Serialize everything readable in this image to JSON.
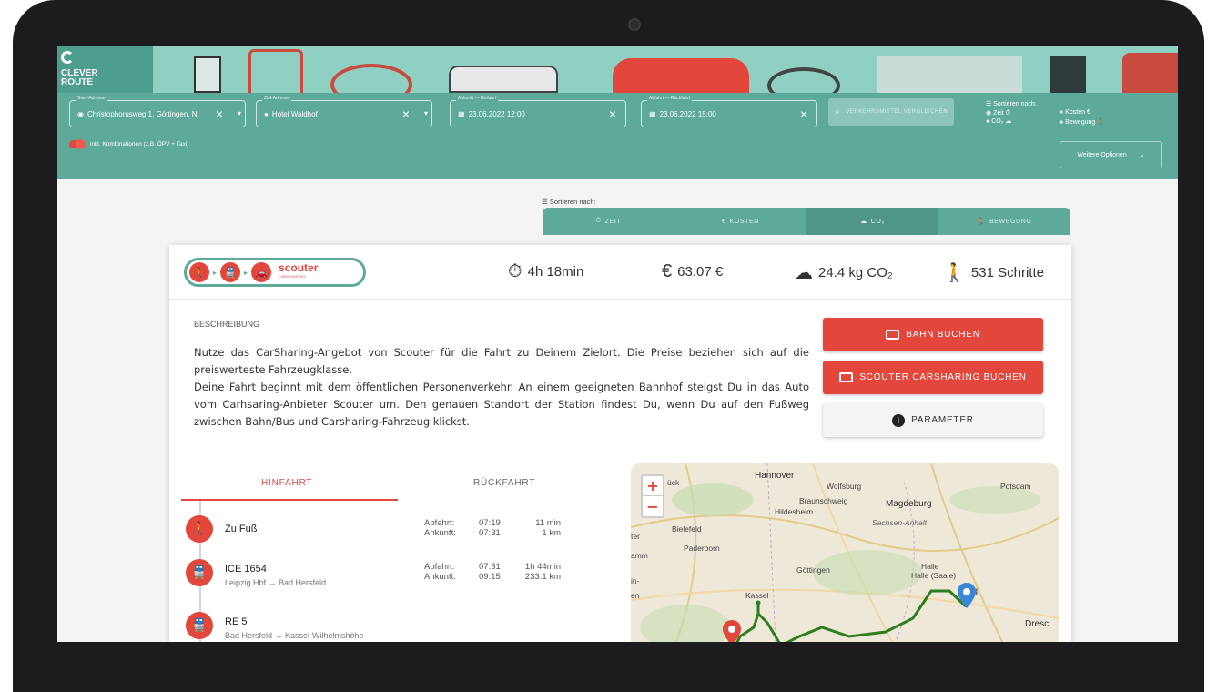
{
  "app": {
    "logo_line1": "CLEVER",
    "logo_line2": "ROUTE"
  },
  "search": {
    "start": {
      "label": "Start-Adresse",
      "value": "Christophorusweg 1, Göttingen, Ni"
    },
    "destination": {
      "label": "Ziel-Adresse",
      "value": "Hotel Waldhof"
    },
    "arrival": {
      "label": "Ankunft — Hinfahrt",
      "value": "23.06.2022 12:00"
    },
    "departure": {
      "label": "Abfahrt — Rückfahrt",
      "value": "23.06.2022 15:00"
    },
    "compare_label": "VERKEHRSMITTEL VERGLEICHEN",
    "combinations_label": "inkl. Kombinationen (z.B. ÖPV + Taxi)",
    "more_options_label": "Weitere Optionen",
    "sort_title": "Sortieren nach:",
    "sort_options": {
      "zeit": "Zeit",
      "co2": "CO₂",
      "kosten": "Kosten",
      "bewegung": "Bewegung"
    }
  },
  "sort_tabs": {
    "title": "Sortieren nach:",
    "zeit": "ZEIT",
    "kosten": "KOSTEN",
    "co2": "CO₂",
    "bewegung": "BEWEGUNG"
  },
  "result": {
    "provider": "scouter",
    "provider_sub": "CARSHARING",
    "duration": "4h 18min",
    "cost": "63.07 €",
    "co2": "24.4 kg CO₂",
    "steps": "531 Schritte",
    "description_heading": "BESCHREIBUNG",
    "description_p1": "Nutze das CarSharing-Angebot von Scouter für die Fahrt zu Deinem Zielort. Die Preise beziehen sich auf die preiswerteste Fahrzeugklasse.",
    "description_p2": "Deine Fahrt beginnt mit dem öffentlichen Personenverkehr. An einem geeigneten Bahnhof steigst Du in das Auto vom Carhsaring-Anbieter Scouter um. Den genauen Standort der Station findest Du, wenn Du auf den Fußweg zwischen Bahn/Bus und Carsharing-Fahrzeug klickst.",
    "btn_bahn": "BAHN BUCHEN",
    "btn_scouter": "SCOUTER CARSHARING BUCHEN",
    "btn_parameter": "PARAMETER",
    "tab_hin": "HINFAHRT",
    "tab_rueck": "RÜCKFAHRT",
    "legs": [
      {
        "name": "Zu Fuß",
        "sub": "",
        "dep_label": "Abfahrt:",
        "dep_time": "07:19",
        "duration": "11 min",
        "arr_label": "Ankunft:",
        "arr_time": "07:31",
        "distance": "1 km"
      },
      {
        "name": "ICE 1654",
        "sub": "Leipzig Hbf → Bad Hersfeld",
        "dep_label": "Abfahrt:",
        "dep_time": "07:31",
        "duration": "1h 44min",
        "arr_label": "Ankunft:",
        "arr_time": "09:15",
        "distance": "233.1 km"
      },
      {
        "name": "RE 5",
        "sub": "Bad Hersfeld → Kassel-Wilhelmshöhe"
      }
    ]
  },
  "map": {
    "cities": [
      "Hannover",
      "Wolfsburg",
      "Braunschweig",
      "Magdeburg",
      "Hildesheim",
      "Sachsen-Anhalt",
      "Bielefeld",
      "Paderborn",
      "Göttingen",
      "Halle",
      "Halle (Saale)",
      "Kassel",
      "Potsdam",
      "Dresc",
      "Lg",
      "ück",
      "ter",
      "amm",
      "in-",
      "en"
    ],
    "zoom_in": "+",
    "zoom_out": "−",
    "route_color": "#2e7d1e",
    "accent": "#e3473c",
    "teal": "#5eaa9a"
  }
}
